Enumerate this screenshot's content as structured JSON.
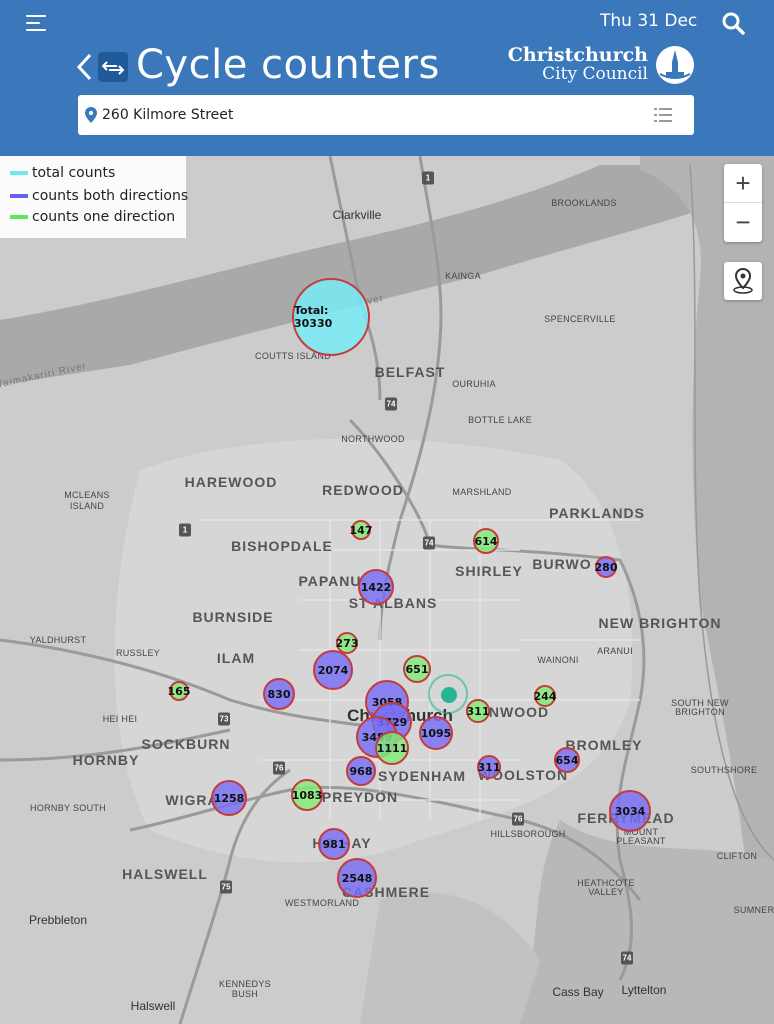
{
  "header": {
    "date": "Thu 31 Dec",
    "title": "Cycle counters",
    "council_line1": "Christchurch",
    "council_line2": "City Council",
    "address": "260 Kilmore Street",
    "colors": {
      "bar": "#3a78bb",
      "accent": "#1f5a99"
    }
  },
  "legend": {
    "total": {
      "label": "total counts",
      "color": "#6fe8f4"
    },
    "both": {
      "label": "counts both directions",
      "color": "#6a60f0"
    },
    "one": {
      "label": "counts one direction",
      "color": "#5ee85a"
    }
  },
  "controls": {
    "zoom_in": "+",
    "zoom_out": "−"
  },
  "places": {
    "clarkville": "Clarkville",
    "brooklands": "BROOKLANDS",
    "kainga": "KAINGA",
    "spencerville": "SPENCERVILLE",
    "coutts_island": "COUTTS ISLAND",
    "belfast": "BELFAST",
    "ouruhia": "OURUHIA",
    "bottle_lake": "BOTTLE LAKE",
    "northwood": "NORTHWOOD",
    "harewood": "HAREWOOD",
    "redwood": "REDWOOD",
    "marshland": "MARSHLAND",
    "mcleans": "MCLEANS",
    "island": "ISLAND",
    "parklands": "PARKLANDS",
    "bishopdale": "BISHOPDALE",
    "shirley": "SHIRLEY",
    "burwood": "BURWO",
    "papanui": "PAPANU",
    "st_albans": "ST ALBANS",
    "burnside": "BURNSIDE",
    "new_brighton": "NEW BRIGHTON",
    "yaldhurst": "YALDHURST",
    "russley": "RUSSLEY",
    "aranui": "ARANUI",
    "ilam": "ILAM",
    "wainoni": "WAINONI",
    "hei_hei": "HEI HEI",
    "christchurch": "Christchurch",
    "linwood": "NWOOD",
    "south_new": "SOUTH NEW",
    "brighton": "BRIGHTON",
    "sockburn": "SOCKBURN",
    "bromley": "BROMLEY",
    "hornby": "HORNBY",
    "sydenham": "SYDENHAM",
    "woolston": "WOOLSTON",
    "southshore": "SOUTHSHORE",
    "hornby_south": "HORNBY SOUTH",
    "wigram": "WIGRA",
    "spreydon": "PREYDON",
    "ferrymead": "FERRYMEAD",
    "hillsborough": "HILLSBOROUGH",
    "mount": "MOUNT",
    "pleasant": "PLEASANT",
    "hoon_hay": "HO    HAY",
    "clifton": "CLIFTON",
    "halswell": "HALSWELL",
    "heathcote": "HEATHCOTE",
    "valley": "VALLEY",
    "cashmere": "CASHMERE",
    "westmorland": "WESTMORLAND",
    "sumner": "SUMNER",
    "prebbleton": "Prebbleton",
    "kennedys": "KENNEDYS",
    "bush": "BUSH",
    "halswell_town": "Halswell",
    "cass_bay": "Cass Bay",
    "lyttelton": "Lyttelton",
    "waimakariri_river": "Waimakariri River",
    "river": "River"
  },
  "route_shields": [
    "1",
    "74",
    "1",
    "74",
    "73",
    "76",
    "75",
    "76",
    "74"
  ],
  "counters": [
    {
      "label": "Total: 30330",
      "value": 30330,
      "type": "total"
    },
    {
      "label": "147",
      "value": 147,
      "type": "one"
    },
    {
      "label": "614",
      "value": 614,
      "type": "one"
    },
    {
      "label": "280",
      "value": 280,
      "type": "both"
    },
    {
      "label": "1422",
      "value": 1422,
      "type": "both"
    },
    {
      "label": "273",
      "value": 273,
      "type": "one"
    },
    {
      "label": "2074",
      "value": 2074,
      "type": "both"
    },
    {
      "label": "651",
      "value": 651,
      "type": "one"
    },
    {
      "label": "165",
      "value": 165,
      "type": "one"
    },
    {
      "label": "830",
      "value": 830,
      "type": "both"
    },
    {
      "label": "3058",
      "value": 3058,
      "type": "both"
    },
    {
      "label": "3729",
      "value": 3729,
      "type": "both"
    },
    {
      "label": "311",
      "value": 311,
      "type": "one"
    },
    {
      "label": "244",
      "value": 244,
      "type": "one"
    },
    {
      "label": "3489",
      "value": 3489,
      "type": "both"
    },
    {
      "label": "1095",
      "value": 1095,
      "type": "both"
    },
    {
      "label": "1111",
      "value": 1111,
      "type": "one"
    },
    {
      "label": "654",
      "value": 654,
      "type": "both"
    },
    {
      "label": "968",
      "value": 968,
      "type": "both"
    },
    {
      "label": "311",
      "value": 311,
      "type": "both"
    },
    {
      "label": "1258",
      "value": 1258,
      "type": "both"
    },
    {
      "label": "1083",
      "value": 1083,
      "type": "one"
    },
    {
      "label": "3034",
      "value": 3034,
      "type": "both"
    },
    {
      "label": "981",
      "value": 981,
      "type": "both"
    },
    {
      "label": "2548",
      "value": 2548,
      "type": "both"
    }
  ]
}
